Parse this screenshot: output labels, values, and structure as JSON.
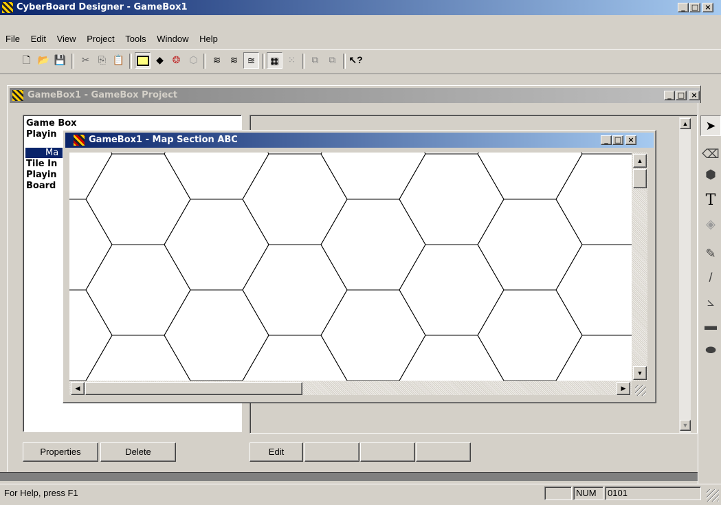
{
  "app": {
    "title": "CyberBoard Designer - GameBox1"
  },
  "menu": {
    "items": [
      "File",
      "Edit",
      "View",
      "Project",
      "Tools",
      "Window",
      "Help"
    ]
  },
  "toolbar": {
    "icons": [
      "new-icon",
      "open-icon",
      "save-icon",
      "cut-icon",
      "copy-icon",
      "paste-icon",
      "board-icon",
      "tile-icon",
      "palette-icon",
      "tiny-hex-icon",
      "layer1-icon",
      "layer2-icon",
      "layer3-icon",
      "grid-icon",
      "dots-icon",
      "tile-back-icon",
      "tile-front-icon",
      "context-help-icon"
    ]
  },
  "project_window": {
    "title": "GameBox1 - GameBox Project",
    "tree": [
      "Game Box",
      "Playin",
      "Ma",
      "Tile In",
      "Playin",
      "Board"
    ],
    "buttons": {
      "properties": "Properties",
      "delete": "Delete",
      "edit": "Edit"
    }
  },
  "map_window": {
    "title": "GameBox1 - Map Section ABC"
  },
  "drawing_tools": [
    "select-arrow-icon",
    "eraser-icon",
    "hexagon-fill-icon",
    "text-tool-icon",
    "fill-bucket-icon",
    "color-picker-icon",
    "line-tool-icon",
    "polyline-icon",
    "rectangle-icon",
    "ellipse-icon"
  ],
  "status": {
    "help": "For Help, press F1",
    "num": "NUM",
    "coord": "0101"
  }
}
